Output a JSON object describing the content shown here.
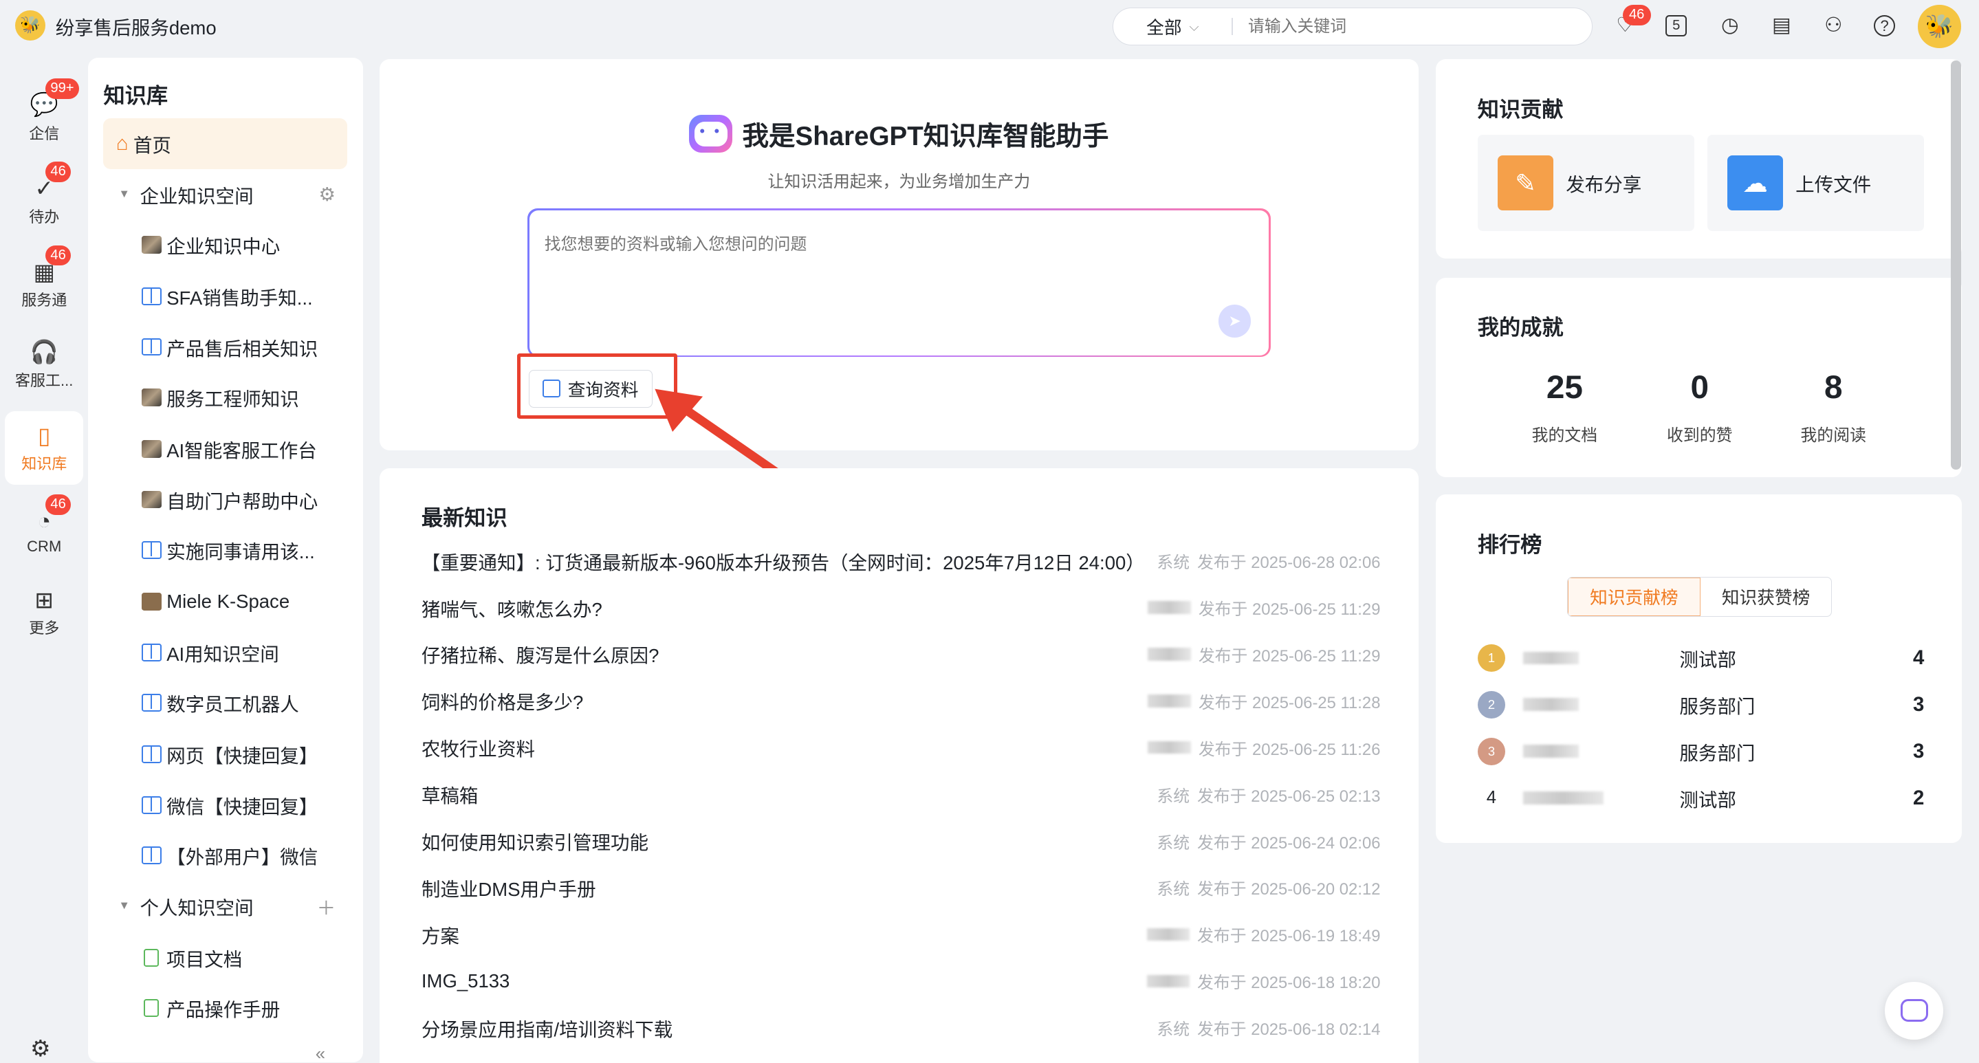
{
  "app": {
    "title": "纷享售后服务demo"
  },
  "topbar": {
    "search_scope": "全部",
    "search_placeholder": "请输入关键词",
    "notification_badge": "46",
    "calendar_label": "5"
  },
  "rail": {
    "items": [
      {
        "label": "企信",
        "badge": "99+"
      },
      {
        "label": "待办",
        "badge": "46"
      },
      {
        "label": "服务通",
        "badge": "46"
      },
      {
        "label": "客服工...",
        "badge": ""
      },
      {
        "label": "知识库",
        "badge": ""
      },
      {
        "label": "CRM",
        "badge": "46"
      },
      {
        "label": "更多",
        "badge": ""
      }
    ]
  },
  "sidebar": {
    "title": "知识库",
    "home": "首页",
    "enterprise_group": "企业知识空间",
    "enterprise_items": [
      "企业知识中心",
      "SFA销售助手知...",
      "产品售后相关知识",
      "服务工程师知识",
      "AI智能客服工作台",
      "自助门户帮助中心",
      "实施同事请用该...",
      "Miele K-Space",
      "AI用知识空间",
      "数字员工机器人",
      "网页【快捷回复】",
      "微信【快捷回复】",
      "【外部用户】微信"
    ],
    "personal_group": "个人知识空间",
    "personal_items": [
      "项目文档",
      "产品操作手册"
    ]
  },
  "assistant": {
    "title": "我是ShareGPT知识库智能助手",
    "subtitle": "让知识活用起来，为业务增加生产力",
    "input_placeholder": "找您想要的资料或输入您想问的问题",
    "query_button": "查询资料"
  },
  "latest": {
    "title": "最新知识",
    "items": [
      {
        "title": "【重要通知】: 订货通最新版本-960版本升级预告（全网时间：2025年7月12日 24:00）",
        "author": "系统",
        "published": "发布于 2025-06-28 02:06"
      },
      {
        "title": "猪喘气、咳嗽怎么办?",
        "author": "",
        "published": "发布于 2025-06-25 11:29"
      },
      {
        "title": "仔猪拉稀、腹泻是什么原因?",
        "author": "",
        "published": "发布于 2025-06-25 11:29"
      },
      {
        "title": "饲料的价格是多少?",
        "author": "",
        "published": "发布于 2025-06-25 11:28"
      },
      {
        "title": "农牧行业资料",
        "author": "",
        "published": "发布于 2025-06-25 11:26"
      },
      {
        "title": "草稿箱",
        "author": "系统",
        "published": "发布于 2025-06-25 02:13"
      },
      {
        "title": "如何使用知识索引管理功能",
        "author": "系统",
        "published": "发布于 2025-06-24 02:06"
      },
      {
        "title": "制造业DMS用户手册",
        "author": "系统",
        "published": "发布于 2025-06-20 02:12"
      },
      {
        "title": "方案",
        "author": "",
        "published": "发布于 2025-06-19 18:49"
      },
      {
        "title": "IMG_5133",
        "author": "",
        "published": "发布于 2025-06-18 18:20"
      },
      {
        "title": "分场景应用指南/培训资料下载",
        "author": "系统",
        "published": "发布于 2025-06-18 02:14"
      }
    ]
  },
  "contribution": {
    "title": "知识贡献",
    "publish": "发布分享",
    "upload": "上传文件"
  },
  "achievement": {
    "title": "我的成就",
    "stats": [
      {
        "value": "25",
        "label": "我的文档"
      },
      {
        "value": "0",
        "label": "收到的赞"
      },
      {
        "value": "8",
        "label": "我的阅读"
      }
    ]
  },
  "ranking": {
    "title": "排行榜",
    "tabs": [
      "知识贡献榜",
      "知识获赞榜"
    ],
    "rows": [
      {
        "rank": "1",
        "dept": "测试部",
        "count": "4"
      },
      {
        "rank": "2",
        "dept": "服务部门",
        "count": "3"
      },
      {
        "rank": "3",
        "dept": "服务部门",
        "count": "3"
      },
      {
        "rank": "4",
        "dept": "测试部",
        "count": "2"
      }
    ]
  },
  "colors": {
    "accent": "#f07a20",
    "badge": "#f5483b",
    "link_blue": "#3c7ee8",
    "annotation_red": "#e8402e"
  }
}
